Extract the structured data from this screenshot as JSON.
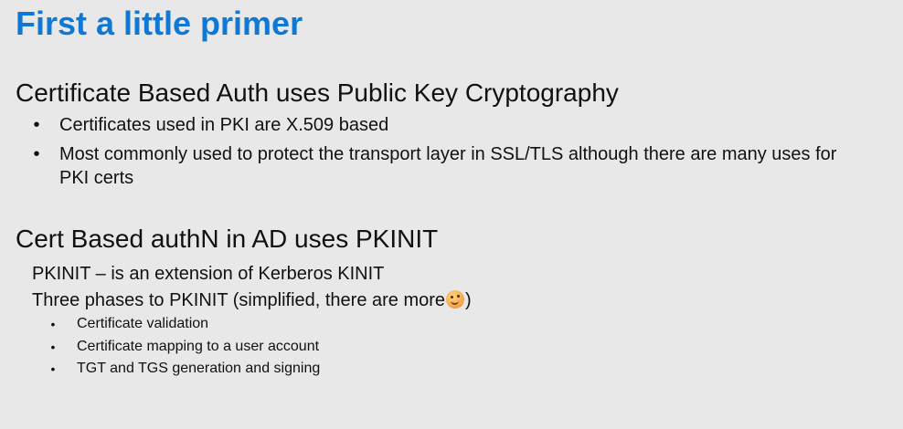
{
  "title": "First a little primer",
  "section1": {
    "heading": "Certificate Based Auth uses Public Key Cryptography",
    "bullets": [
      "Certificates used in PKI are X.509 based",
      "Most commonly used to protect the transport layer in SSL/TLS although there are many uses for PKI certs"
    ]
  },
  "section2": {
    "heading": "Cert Based authN in AD uses PKINIT",
    "line1": "PKINIT – is an extension of Kerberos KINIT",
    "line2_before": "Three phases to PKINIT (simplified, there are more",
    "line2_after": ")",
    "emoji_icon": "smiling-face-emoji",
    "sub_bullets": [
      "Certificate validation",
      "Certificate mapping to a user account",
      "TGT and TGS generation and signing"
    ]
  },
  "bullet_char": "•",
  "colors": {
    "title": "#0f78d4",
    "background": "#e8e8e8",
    "text": "#111111"
  }
}
